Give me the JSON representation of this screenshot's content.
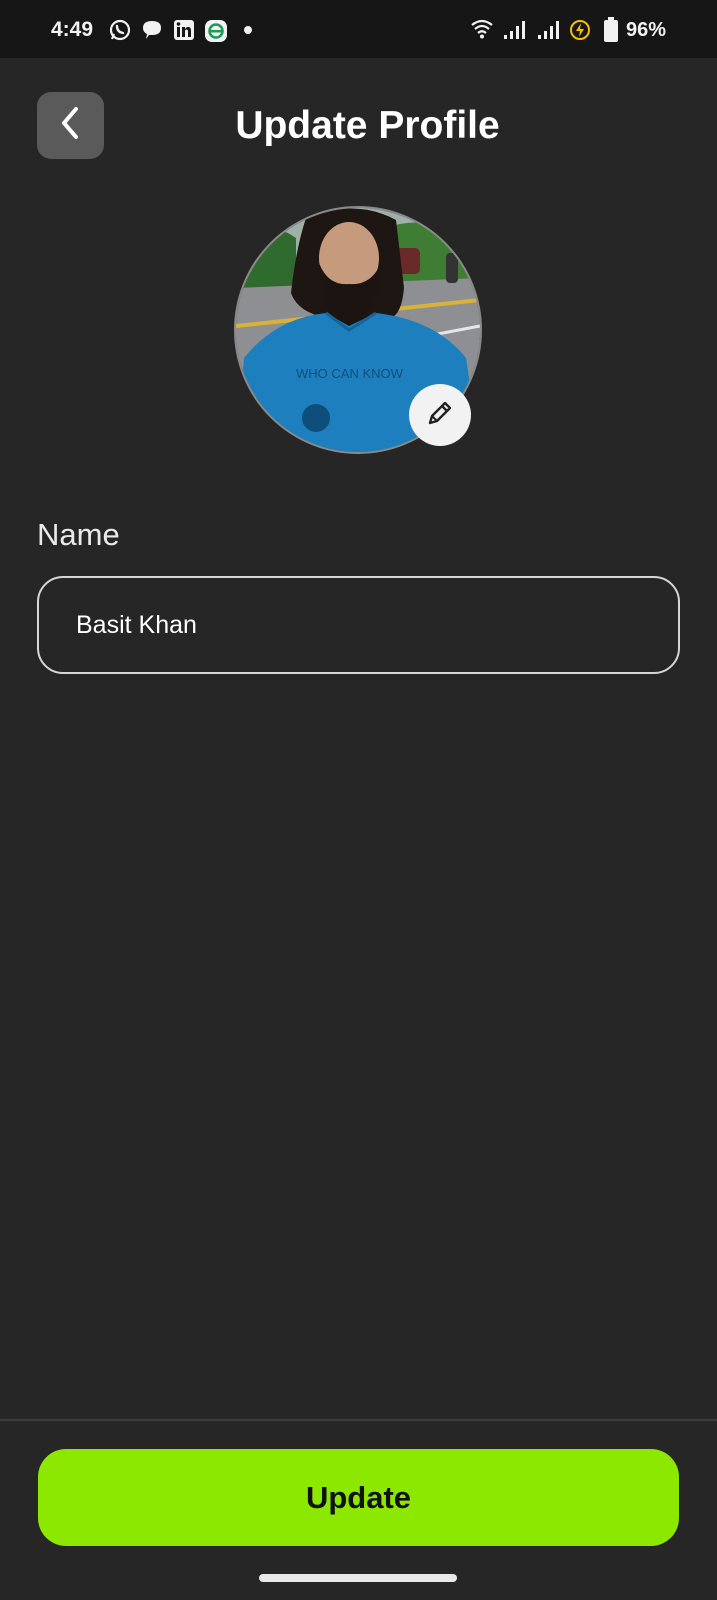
{
  "status_bar": {
    "time": "4:49",
    "battery": "96%",
    "left_icons": [
      "whatsapp-icon",
      "chat-icon",
      "linkedin-icon",
      "app-e-icon",
      "notification-dot"
    ],
    "right_icons": [
      "wifi-icon",
      "signal-icon",
      "signal-icon",
      "battery-saver-icon",
      "battery-icon"
    ]
  },
  "header": {
    "title": "Update Profile",
    "back_icon": "chevron-left-icon"
  },
  "avatar": {
    "edit_icon": "pencil-icon"
  },
  "form": {
    "name_label": "Name",
    "name_value": "Basit Khan"
  },
  "actions": {
    "update_label": "Update"
  },
  "colors": {
    "background": "#262626",
    "status_bar": "#161616",
    "accent": "#8de800",
    "back_button": "#5a5a5a"
  }
}
